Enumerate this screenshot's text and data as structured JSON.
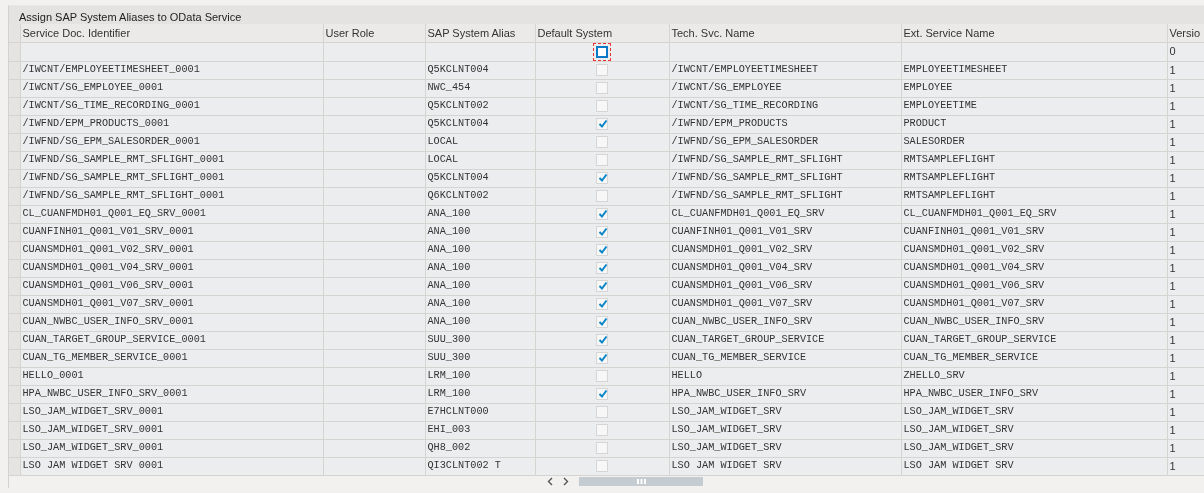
{
  "panel": {
    "title": "Assign SAP System Aliases to OData Service"
  },
  "table": {
    "columns": [
      "Service Doc. Identifier",
      "User Role",
      "SAP System Alias",
      "Default System",
      "Tech. Svc. Name",
      "Ext. Service Name",
      "Versio"
    ],
    "entry_row": {
      "default": false,
      "focused": true,
      "version": "0"
    },
    "rows": [
      {
        "identifier": "/IWCNT/EMPLOYEETIMESHEET_0001",
        "alias": "Q5KCLNT004",
        "default": false,
        "tech": "/IWCNT/EMPLOYEETIMESHEET",
        "ext": "EMPLOYEETIMESHEET",
        "version": "1"
      },
      {
        "identifier": "/IWCNT/SG_EMPLOYEE_0001",
        "alias": "NWC_454",
        "default": false,
        "tech": "/IWCNT/SG_EMPLOYEE",
        "ext": "EMPLOYEE",
        "version": "1"
      },
      {
        "identifier": "/IWCNT/SG_TIME_RECORDING_0001",
        "alias": "Q5KCLNT002",
        "default": false,
        "tech": "/IWCNT/SG_TIME_RECORDING",
        "ext": "EMPLOYEETIME",
        "version": "1"
      },
      {
        "identifier": "/IWFND/EPM_PRODUCTS_0001",
        "alias": "Q5KCLNT004",
        "default": true,
        "tech": "/IWFND/EPM_PRODUCTS",
        "ext": "PRODUCT",
        "version": "1"
      },
      {
        "identifier": "/IWFND/SG_EPM_SALESORDER_0001",
        "alias": "LOCAL",
        "default": false,
        "tech": "/IWFND/SG_EPM_SALESORDER",
        "ext": "SALESORDER",
        "version": "1"
      },
      {
        "identifier": "/IWFND/SG_SAMPLE_RMT_SFLIGHT_0001",
        "alias": "LOCAL",
        "default": false,
        "tech": "/IWFND/SG_SAMPLE_RMT_SFLIGHT",
        "ext": "RMTSAMPLEFLIGHT",
        "version": "1"
      },
      {
        "identifier": "/IWFND/SG_SAMPLE_RMT_SFLIGHT_0001",
        "alias": "Q5KCLNT004",
        "default": true,
        "tech": "/IWFND/SG_SAMPLE_RMT_SFLIGHT",
        "ext": "RMTSAMPLEFLIGHT",
        "version": "1"
      },
      {
        "identifier": "/IWFND/SG_SAMPLE_RMT_SFLIGHT_0001",
        "alias": "Q6KCLNT002",
        "default": false,
        "tech": "/IWFND/SG_SAMPLE_RMT_SFLIGHT",
        "ext": "RMTSAMPLEFLIGHT",
        "version": "1"
      },
      {
        "identifier": "CL_CUANFMDH01_Q001_EQ_SRV_0001",
        "alias": "ANA_100",
        "default": true,
        "tech": "CL_CUANFMDH01_Q001_EQ_SRV",
        "ext": "CL_CUANFMDH01_Q001_EQ_SRV",
        "version": "1"
      },
      {
        "identifier": "CUANFINH01_Q001_V01_SRV_0001",
        "alias": "ANA_100",
        "default": true,
        "tech": "CUANFINH01_Q001_V01_SRV",
        "ext": "CUANFINH01_Q001_V01_SRV",
        "version": "1"
      },
      {
        "identifier": "CUANSMDH01_Q001_V02_SRV_0001",
        "alias": "ANA_100",
        "default": true,
        "tech": "CUANSMDH01_Q001_V02_SRV",
        "ext": "CUANSMDH01_Q001_V02_SRV",
        "version": "1"
      },
      {
        "identifier": "CUANSMDH01_Q001_V04_SRV_0001",
        "alias": "ANA_100",
        "default": true,
        "tech": "CUANSMDH01_Q001_V04_SRV",
        "ext": "CUANSMDH01_Q001_V04_SRV",
        "version": "1"
      },
      {
        "identifier": "CUANSMDH01_Q001_V06_SRV_0001",
        "alias": "ANA_100",
        "default": true,
        "tech": "CUANSMDH01_Q001_V06_SRV",
        "ext": "CUANSMDH01_Q001_V06_SRV",
        "version": "1"
      },
      {
        "identifier": "CUANSMDH01_Q001_V07_SRV_0001",
        "alias": "ANA_100",
        "default": true,
        "tech": "CUANSMDH01_Q001_V07_SRV",
        "ext": "CUANSMDH01_Q001_V07_SRV",
        "version": "1"
      },
      {
        "identifier": "CUAN_NWBC_USER_INFO_SRV_0001",
        "alias": "ANA_100",
        "default": true,
        "tech": "CUAN_NWBC_USER_INFO_SRV",
        "ext": "CUAN_NWBC_USER_INFO_SRV",
        "version": "1"
      },
      {
        "identifier": "CUAN_TARGET_GROUP_SERVICE_0001",
        "alias": "SUU_300",
        "default": true,
        "tech": "CUAN_TARGET_GROUP_SERVICE",
        "ext": "CUAN_TARGET_GROUP_SERVICE",
        "version": "1"
      },
      {
        "identifier": "CUAN_TG_MEMBER_SERVICE_0001",
        "alias": "SUU_300",
        "default": true,
        "tech": "CUAN_TG_MEMBER_SERVICE",
        "ext": "CUAN_TG_MEMBER_SERVICE",
        "version": "1"
      },
      {
        "identifier": "HELLO_0001",
        "alias": "LRM_100",
        "default": false,
        "tech": "HELLO",
        "ext": "ZHELLO_SRV",
        "version": "1"
      },
      {
        "identifier": "HPA_NWBC_USER_INFO_SRV_0001",
        "alias": "LRM_100",
        "default": true,
        "tech": "HPA_NWBC_USER_INFO_SRV",
        "ext": "HPA_NWBC_USER_INFO_SRV",
        "version": "1"
      },
      {
        "identifier": "LSO_JAM_WIDGET_SRV_0001",
        "alias": "E7HCLNT000",
        "default": false,
        "tech": "LSO_JAM_WIDGET_SRV",
        "ext": "LSO_JAM_WIDGET_SRV",
        "version": "1"
      },
      {
        "identifier": "LSO_JAM_WIDGET_SRV_0001",
        "alias": "EHI_003",
        "default": false,
        "tech": "LSO_JAM_WIDGET_SRV",
        "ext": "LSO_JAM_WIDGET_SRV",
        "version": "1"
      },
      {
        "identifier": "LSO_JAM_WIDGET_SRV_0001",
        "alias": "QH8_002",
        "default": false,
        "tech": "LSO_JAM_WIDGET_SRV",
        "ext": "LSO_JAM_WIDGET_SRV",
        "version": "1"
      },
      {
        "identifier": "LSO JAM WIDGET SRV 0001",
        "alias": "QI3CLNT002 T",
        "default": false,
        "tech": "LSO JAM WIDGET SRV",
        "ext": "LSO JAM WIDGET SRV",
        "version": "1"
      }
    ]
  }
}
